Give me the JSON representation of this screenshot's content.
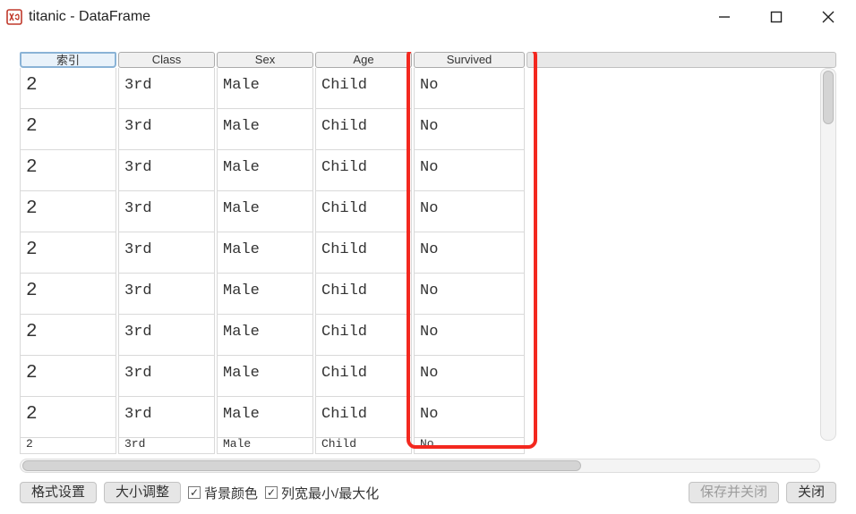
{
  "window": {
    "title": "titanic - DataFrame"
  },
  "table": {
    "index_header": "索引",
    "columns": [
      "Class",
      "Sex",
      "Age",
      "Survived"
    ],
    "rows": [
      {
        "index": "2",
        "Class": "3rd",
        "Sex": "Male",
        "Age": "Child",
        "Survived": "No"
      },
      {
        "index": "2",
        "Class": "3rd",
        "Sex": "Male",
        "Age": "Child",
        "Survived": "No"
      },
      {
        "index": "2",
        "Class": "3rd",
        "Sex": "Male",
        "Age": "Child",
        "Survived": "No"
      },
      {
        "index": "2",
        "Class": "3rd",
        "Sex": "Male",
        "Age": "Child",
        "Survived": "No"
      },
      {
        "index": "2",
        "Class": "3rd",
        "Sex": "Male",
        "Age": "Child",
        "Survived": "No"
      },
      {
        "index": "2",
        "Class": "3rd",
        "Sex": "Male",
        "Age": "Child",
        "Survived": "No"
      },
      {
        "index": "2",
        "Class": "3rd",
        "Sex": "Male",
        "Age": "Child",
        "Survived": "No"
      },
      {
        "index": "2",
        "Class": "3rd",
        "Sex": "Male",
        "Age": "Child",
        "Survived": "No"
      },
      {
        "index": "2",
        "Class": "3rd",
        "Sex": "Male",
        "Age": "Child",
        "Survived": "No"
      },
      {
        "index": "2",
        "Class": "3rd",
        "Sex": "Male",
        "Age": "Child",
        "Survived": "No"
      }
    ]
  },
  "footer": {
    "format_btn": "格式设置",
    "resize_btn": "大小调整",
    "bg_color_label": "背景颜色",
    "col_width_label": "列宽最小/最大化",
    "save_close_btn": "保存并关闭",
    "close_btn": "关闭"
  },
  "highlight": {
    "column": "Survived"
  },
  "checkmark": "✓"
}
